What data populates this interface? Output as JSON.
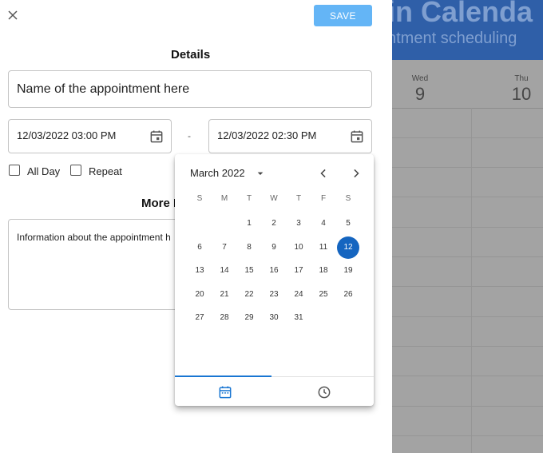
{
  "background_calendar": {
    "title": "in Calenda",
    "subtitle": "ntment scheduling",
    "days": [
      {
        "name": "Wed",
        "number": "9"
      },
      {
        "name": "Thu",
        "number": "10"
      }
    ]
  },
  "panel": {
    "save_label": "SAVE",
    "details_title": "Details",
    "name_value": "Name of the appointment here",
    "start_datetime": "12/03/2022 03:00 PM",
    "separator": "-",
    "end_datetime": "12/03/2022 02:30 PM",
    "all_day_label": "All Day",
    "repeat_label": "Repeat",
    "more_title": "More I",
    "notes_value": "Information about the appointment h"
  },
  "date_picker": {
    "month_year": "March 2022",
    "weekdays": [
      "S",
      "M",
      "T",
      "W",
      "T",
      "F",
      "S"
    ],
    "selected_day": "12",
    "days": [
      "1",
      "2",
      "3",
      "4",
      "5",
      "6",
      "7",
      "8",
      "9",
      "10",
      "11",
      "12",
      "13",
      "14",
      "15",
      "16",
      "17",
      "18",
      "19",
      "20",
      "21",
      "22",
      "23",
      "24",
      "25",
      "26",
      "27",
      "28",
      "29",
      "30",
      "31"
    ]
  },
  "icons": {
    "close": "close-icon",
    "calendar": "calendar-icon",
    "chevron_left": "chevron-left-icon",
    "chevron_right": "chevron-right-icon",
    "dropdown": "dropdown-arrow-icon",
    "clock": "clock-icon"
  },
  "colors": {
    "save_button": "#64b5f6",
    "selected_day": "#1565c0",
    "accent": "#1976d2",
    "background_header": "#2f5fa8"
  }
}
